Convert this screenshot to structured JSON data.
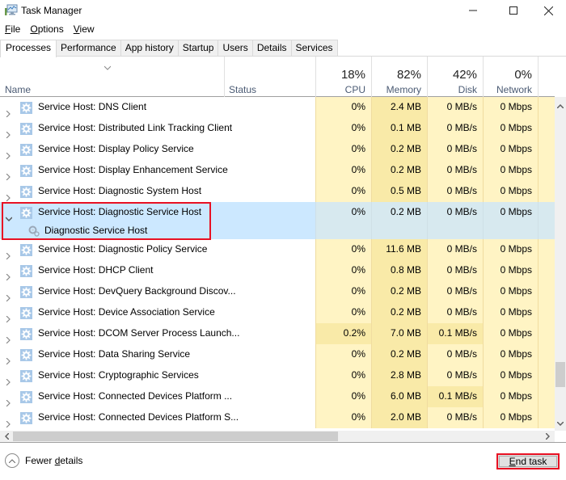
{
  "window": {
    "title": "Task Manager",
    "controls": {
      "minimize": "—",
      "maximize": "☐",
      "close": "✕"
    }
  },
  "menu": [
    {
      "key": "F",
      "rest": "ile"
    },
    {
      "key": "O",
      "rest": "ptions"
    },
    {
      "key": "V",
      "rest": "iew"
    }
  ],
  "tabs": [
    "Processes",
    "Performance",
    "App history",
    "Startup",
    "Users",
    "Details",
    "Services"
  ],
  "active_tab": "Processes",
  "columns": {
    "name": "Name",
    "status": "Status",
    "cpu": {
      "pct": "18%",
      "label": "CPU"
    },
    "memory": {
      "pct": "82%",
      "label": "Memory"
    },
    "disk": {
      "pct": "42%",
      "label": "Disk"
    },
    "network": {
      "pct": "0%",
      "label": "Network"
    }
  },
  "rows": [
    {
      "name": "Service Host: DNS Client",
      "cpu": "0%",
      "memory": "2.4 MB",
      "disk": "0 MB/s",
      "network": "0 Mbps"
    },
    {
      "name": "Service Host: Distributed Link Tracking Client",
      "cpu": "0%",
      "memory": "0.1 MB",
      "disk": "0 MB/s",
      "network": "0 Mbps"
    },
    {
      "name": "Service Host: Display Policy Service",
      "cpu": "0%",
      "memory": "0.2 MB",
      "disk": "0 MB/s",
      "network": "0 Mbps"
    },
    {
      "name": "Service Host: Display Enhancement Service",
      "cpu": "0%",
      "memory": "0.2 MB",
      "disk": "0 MB/s",
      "network": "0 Mbps"
    },
    {
      "name": "Service Host: Diagnostic System Host",
      "cpu": "0%",
      "memory": "0.5 MB",
      "disk": "0 MB/s",
      "network": "0 Mbps"
    },
    {
      "name": "Service Host: Diagnostic Service Host",
      "cpu": "0%",
      "memory": "0.2 MB",
      "disk": "0 MB/s",
      "network": "0 Mbps",
      "expanded": true,
      "selected": true,
      "child": "Diagnostic Service Host"
    },
    {
      "name": "Service Host: Diagnostic Policy Service",
      "cpu": "0%",
      "memory": "11.6 MB",
      "disk": "0 MB/s",
      "network": "0 Mbps"
    },
    {
      "name": "Service Host: DHCP Client",
      "cpu": "0%",
      "memory": "0.8 MB",
      "disk": "0 MB/s",
      "network": "0 Mbps"
    },
    {
      "name": "Service Host: DevQuery Background Discov...",
      "cpu": "0%",
      "memory": "0.2 MB",
      "disk": "0 MB/s",
      "network": "0 Mbps"
    },
    {
      "name": "Service Host: Device Association Service",
      "cpu": "0%",
      "memory": "0.2 MB",
      "disk": "0 MB/s",
      "network": "0 Mbps"
    },
    {
      "name": "Service Host: DCOM Server Process Launch...",
      "cpu": "0.2%",
      "memory": "7.0 MB",
      "disk": "0.1 MB/s",
      "network": "0 Mbps",
      "hi_cpu": true,
      "hi_disk": true
    },
    {
      "name": "Service Host: Data Sharing Service",
      "cpu": "0%",
      "memory": "0.2 MB",
      "disk": "0 MB/s",
      "network": "0 Mbps"
    },
    {
      "name": "Service Host: Cryptographic Services",
      "cpu": "0%",
      "memory": "2.8 MB",
      "disk": "0 MB/s",
      "network": "0 Mbps"
    },
    {
      "name": "Service Host: Connected Devices Platform ...",
      "cpu": "0%",
      "memory": "6.0 MB",
      "disk": "0.1 MB/s",
      "network": "0 Mbps",
      "hi_disk": true
    },
    {
      "name": "Service Host: Connected Devices Platform S...",
      "cpu": "0%",
      "memory": "2.0 MB",
      "disk": "0 MB/s",
      "network": "0 Mbps"
    }
  ],
  "footer": {
    "fewer_details_pre": "Fewer ",
    "fewer_details_key": "d",
    "fewer_details_post": "etails",
    "end_task_key": "E",
    "end_task_rest": "nd task"
  },
  "colors": {
    "highlight_border": "#e81123",
    "selected_row": "#cce8ff",
    "heat_light": "#fff4c4",
    "heat_mid": "#f9eaa8"
  }
}
